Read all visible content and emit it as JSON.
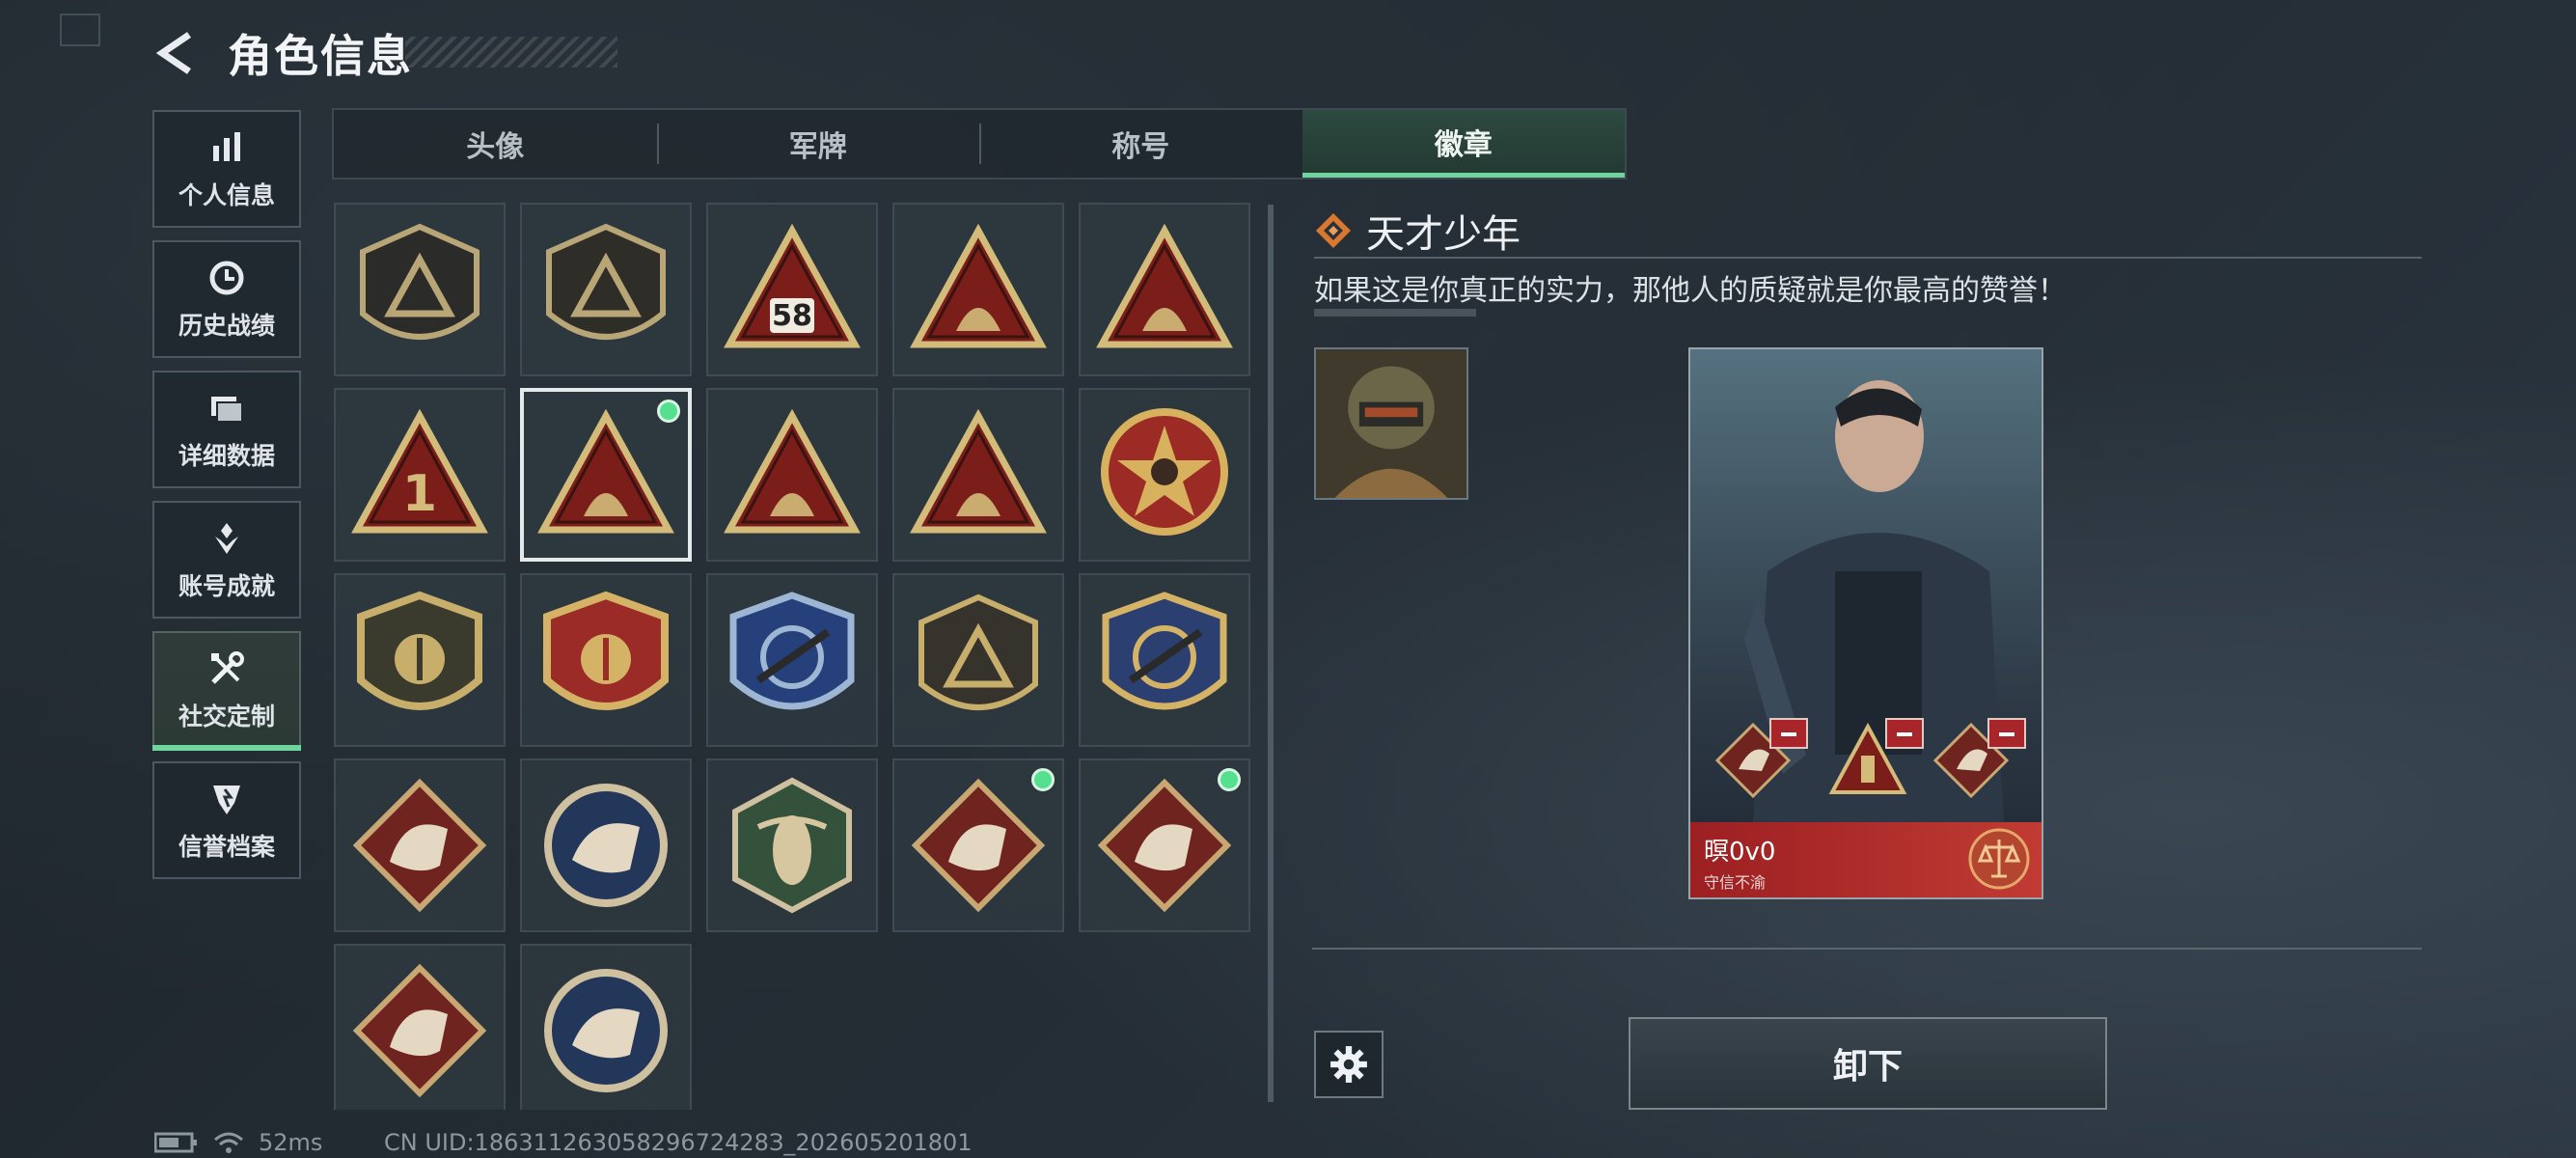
{
  "header": {
    "title": "角色信息"
  },
  "nav": {
    "items": [
      {
        "label": "个人信息",
        "icon": "bar-chart-icon"
      },
      {
        "label": "历史战绩",
        "icon": "clock-icon"
      },
      {
        "label": "详细数据",
        "icon": "folder-icon"
      },
      {
        "label": "账号成就",
        "icon": "achievement-icon"
      },
      {
        "label": "社交定制",
        "icon": "tools-icon",
        "active": true
      },
      {
        "label": "信誉档案",
        "icon": "shield-icon"
      }
    ]
  },
  "tabs": [
    {
      "label": "头像"
    },
    {
      "label": "军牌"
    },
    {
      "label": "称号"
    },
    {
      "label": "徽章",
      "active": true
    }
  ],
  "badges": [
    {
      "name": "chevron-triangle-badge",
      "shape": "shield-dark",
      "fill": "#2b2b29",
      "accent": "#b9a676",
      "equipped": false
    },
    {
      "name": "helicopter-badge",
      "shape": "shield-dark",
      "fill": "#2e2d28",
      "accent": "#b9a676",
      "equipped": false
    },
    {
      "name": "rank-58-badge",
      "shape": "triangle",
      "fill": "#7b1e1a",
      "accent": "#d3bb7a",
      "text": "58",
      "equipped": false
    },
    {
      "name": "nest-badge",
      "shape": "triangle",
      "fill": "#7b1e1a",
      "accent": "#d3bb7a",
      "equipped": false
    },
    {
      "name": "tank-badge",
      "shape": "triangle",
      "fill": "#7b1e1a",
      "accent": "#d3bb7a",
      "equipped": false
    },
    {
      "name": "number-one-badge",
      "shape": "triangle",
      "fill": "#7b1e1a",
      "accent": "#d3bb7a",
      "text": "1",
      "equipped": false
    },
    {
      "name": "tower-badge",
      "shape": "triangle",
      "fill": "#7b1e1a",
      "accent": "#d3bb7a",
      "equipped": true,
      "selected": true
    },
    {
      "name": "soldiers-badge",
      "shape": "triangle",
      "fill": "#7b1e1a",
      "accent": "#d3bb7a",
      "equipped": false
    },
    {
      "name": "rocket-badge",
      "shape": "triangle",
      "fill": "#7b1e1a",
      "accent": "#d3bb7a",
      "equipped": false
    },
    {
      "name": "star-emblem-badge",
      "shape": "round-star",
      "fill": "#9c2a25",
      "accent": "#d8b15e",
      "equipped": false
    },
    {
      "name": "wing-shield-badge",
      "shape": "shield-gold",
      "fill": "#3b3b2d",
      "accent": "#c7ae6a",
      "equipped": false
    },
    {
      "name": "red-crest-badge",
      "shape": "shield-gold",
      "fill": "#9a2b27",
      "accent": "#d4b266",
      "equipped": false
    },
    {
      "name": "rifle-blue-badge",
      "shape": "shield-blue",
      "fill": "#25407a",
      "accent": "#9cb6d4",
      "equipped": false
    },
    {
      "name": "rifle-dark-badge",
      "shape": "shield-dark",
      "fill": "#36332c",
      "accent": "#c7ae6a",
      "equipped": false
    },
    {
      "name": "blade-crest-badge",
      "shape": "shield-blue",
      "fill": "#2b3f70",
      "accent": "#d4b266",
      "equipped": false
    },
    {
      "name": "tiger-badge",
      "shape": "diamond",
      "fill": "#6f2420",
      "accent": "#e5d8c3",
      "equipped": false
    },
    {
      "name": "eagle-badge",
      "shape": "circle",
      "fill": "#23375a",
      "accent": "#e5d8c3",
      "equipped": false
    },
    {
      "name": "hornet-badge",
      "shape": "hexagon",
      "fill": "#34513c",
      "accent": "#d6c7a1",
      "equipped": false
    },
    {
      "name": "dragon-badge",
      "shape": "diamond",
      "fill": "#6f2420",
      "accent": "#e5d8c3",
      "equipped": true
    },
    {
      "name": "dragon-badge-2",
      "shape": "diamond",
      "fill": "#6f2420",
      "accent": "#e5d8c3",
      "equipped": true
    },
    {
      "name": "runner-badge",
      "shape": "diamond",
      "fill": "#6f2420",
      "accent": "#e5d8c3",
      "equipped": false
    },
    {
      "name": "wolf-badge",
      "shape": "circle",
      "fill": "#23375a",
      "accent": "#e5d8c3",
      "equipped": false
    }
  ],
  "detail": {
    "name": "天才少年",
    "description": "如果这是你真正的实力，那他人的质疑就是你最高的赞誉！",
    "card": {
      "player_name": "暝0v0",
      "subtitle": "守信不渝"
    },
    "unequip_label": "卸下"
  },
  "status": {
    "ping": "52ms",
    "uid": "CN UID:18631126305829672428З_202605201801"
  },
  "colors": {
    "accent_green": "#6ed59e",
    "equipped_dot": "#55e08f",
    "card_red": "#b8302c"
  }
}
